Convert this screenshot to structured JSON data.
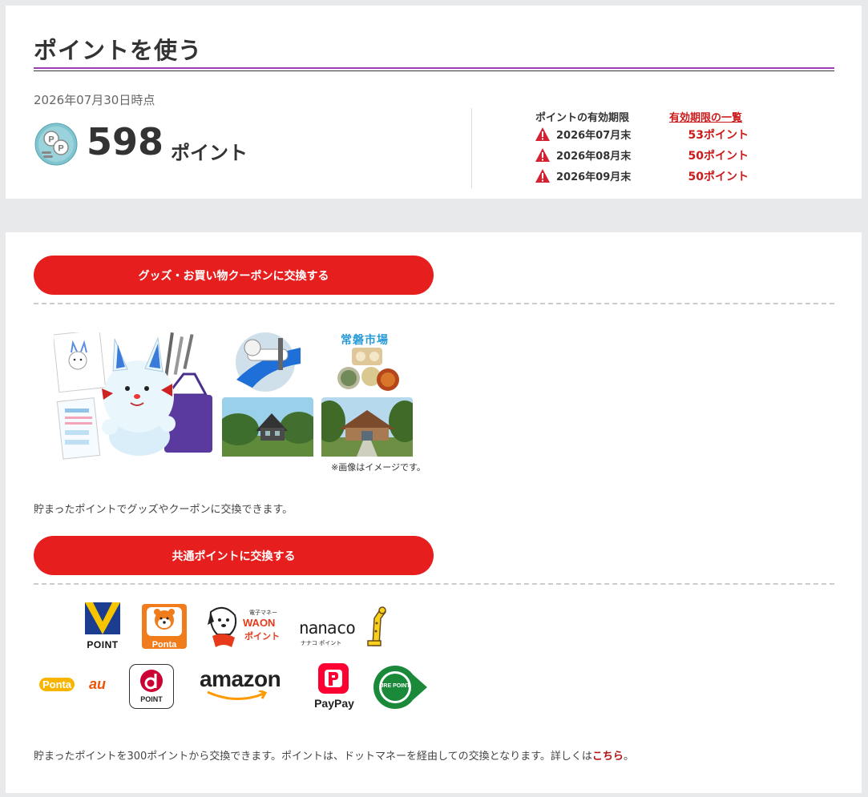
{
  "header": {
    "title": "ポイントを使う",
    "as_of": "2026年07月30日時点",
    "points_value": "598",
    "points_unit": "ポイント"
  },
  "expiry": {
    "title": "ポイントの有効期限",
    "list_link": "有効期限の一覧",
    "rows": [
      {
        "date": "2026年07月末",
        "points": "53ポイント"
      },
      {
        "date": "2026年08月末",
        "points": "50ポイント"
      },
      {
        "date": "2026年09月末",
        "points": "50ポイント"
      }
    ]
  },
  "goods": {
    "button_label": "グッズ・お買い物クーポンに交換する",
    "market_label": "常磐市場",
    "image_note": "※画像はイメージです。",
    "description": "貯まったポイントでグッズやクーポンに交換できます。"
  },
  "common": {
    "button_label": "共通ポイントに交換する",
    "description_prefix": "貯まったポイントを300ポイントから交換できます。ポイントは、ドットマネーを経由しての交換となります。詳しくは",
    "description_link": "こちら",
    "description_suffix": "。",
    "logos": {
      "vpoint": {
        "name": "v-point-logo",
        "text": "POINT"
      },
      "ponta": {
        "name": "ponta-logo",
        "text": "Ponta"
      },
      "waon": {
        "name": "waon-point-logo",
        "small": "電子マネー",
        "main": "WAON",
        "sub": "ポイント"
      },
      "nanaco": {
        "name": "nanaco-point-logo",
        "main": "nanaco",
        "sub": "ナナコ ポイント"
      },
      "ponta_au": {
        "name": "ponta-au-logo",
        "ponta": "Ponta",
        "au": "au"
      },
      "dpoint": {
        "name": "d-point-logo",
        "text": "POINT"
      },
      "amazon": {
        "name": "amazon-logo",
        "text": "amazon"
      },
      "paypay": {
        "name": "paypay-logo",
        "text": "PayPay"
      },
      "jre": {
        "name": "jre-point-logo",
        "text": "JRE POINT"
      }
    }
  },
  "colors": {
    "accent_red": "#e61e1e",
    "link_red": "#cc1a1a",
    "title_rule": "#a03cb4",
    "background": "#e8e9eb"
  }
}
